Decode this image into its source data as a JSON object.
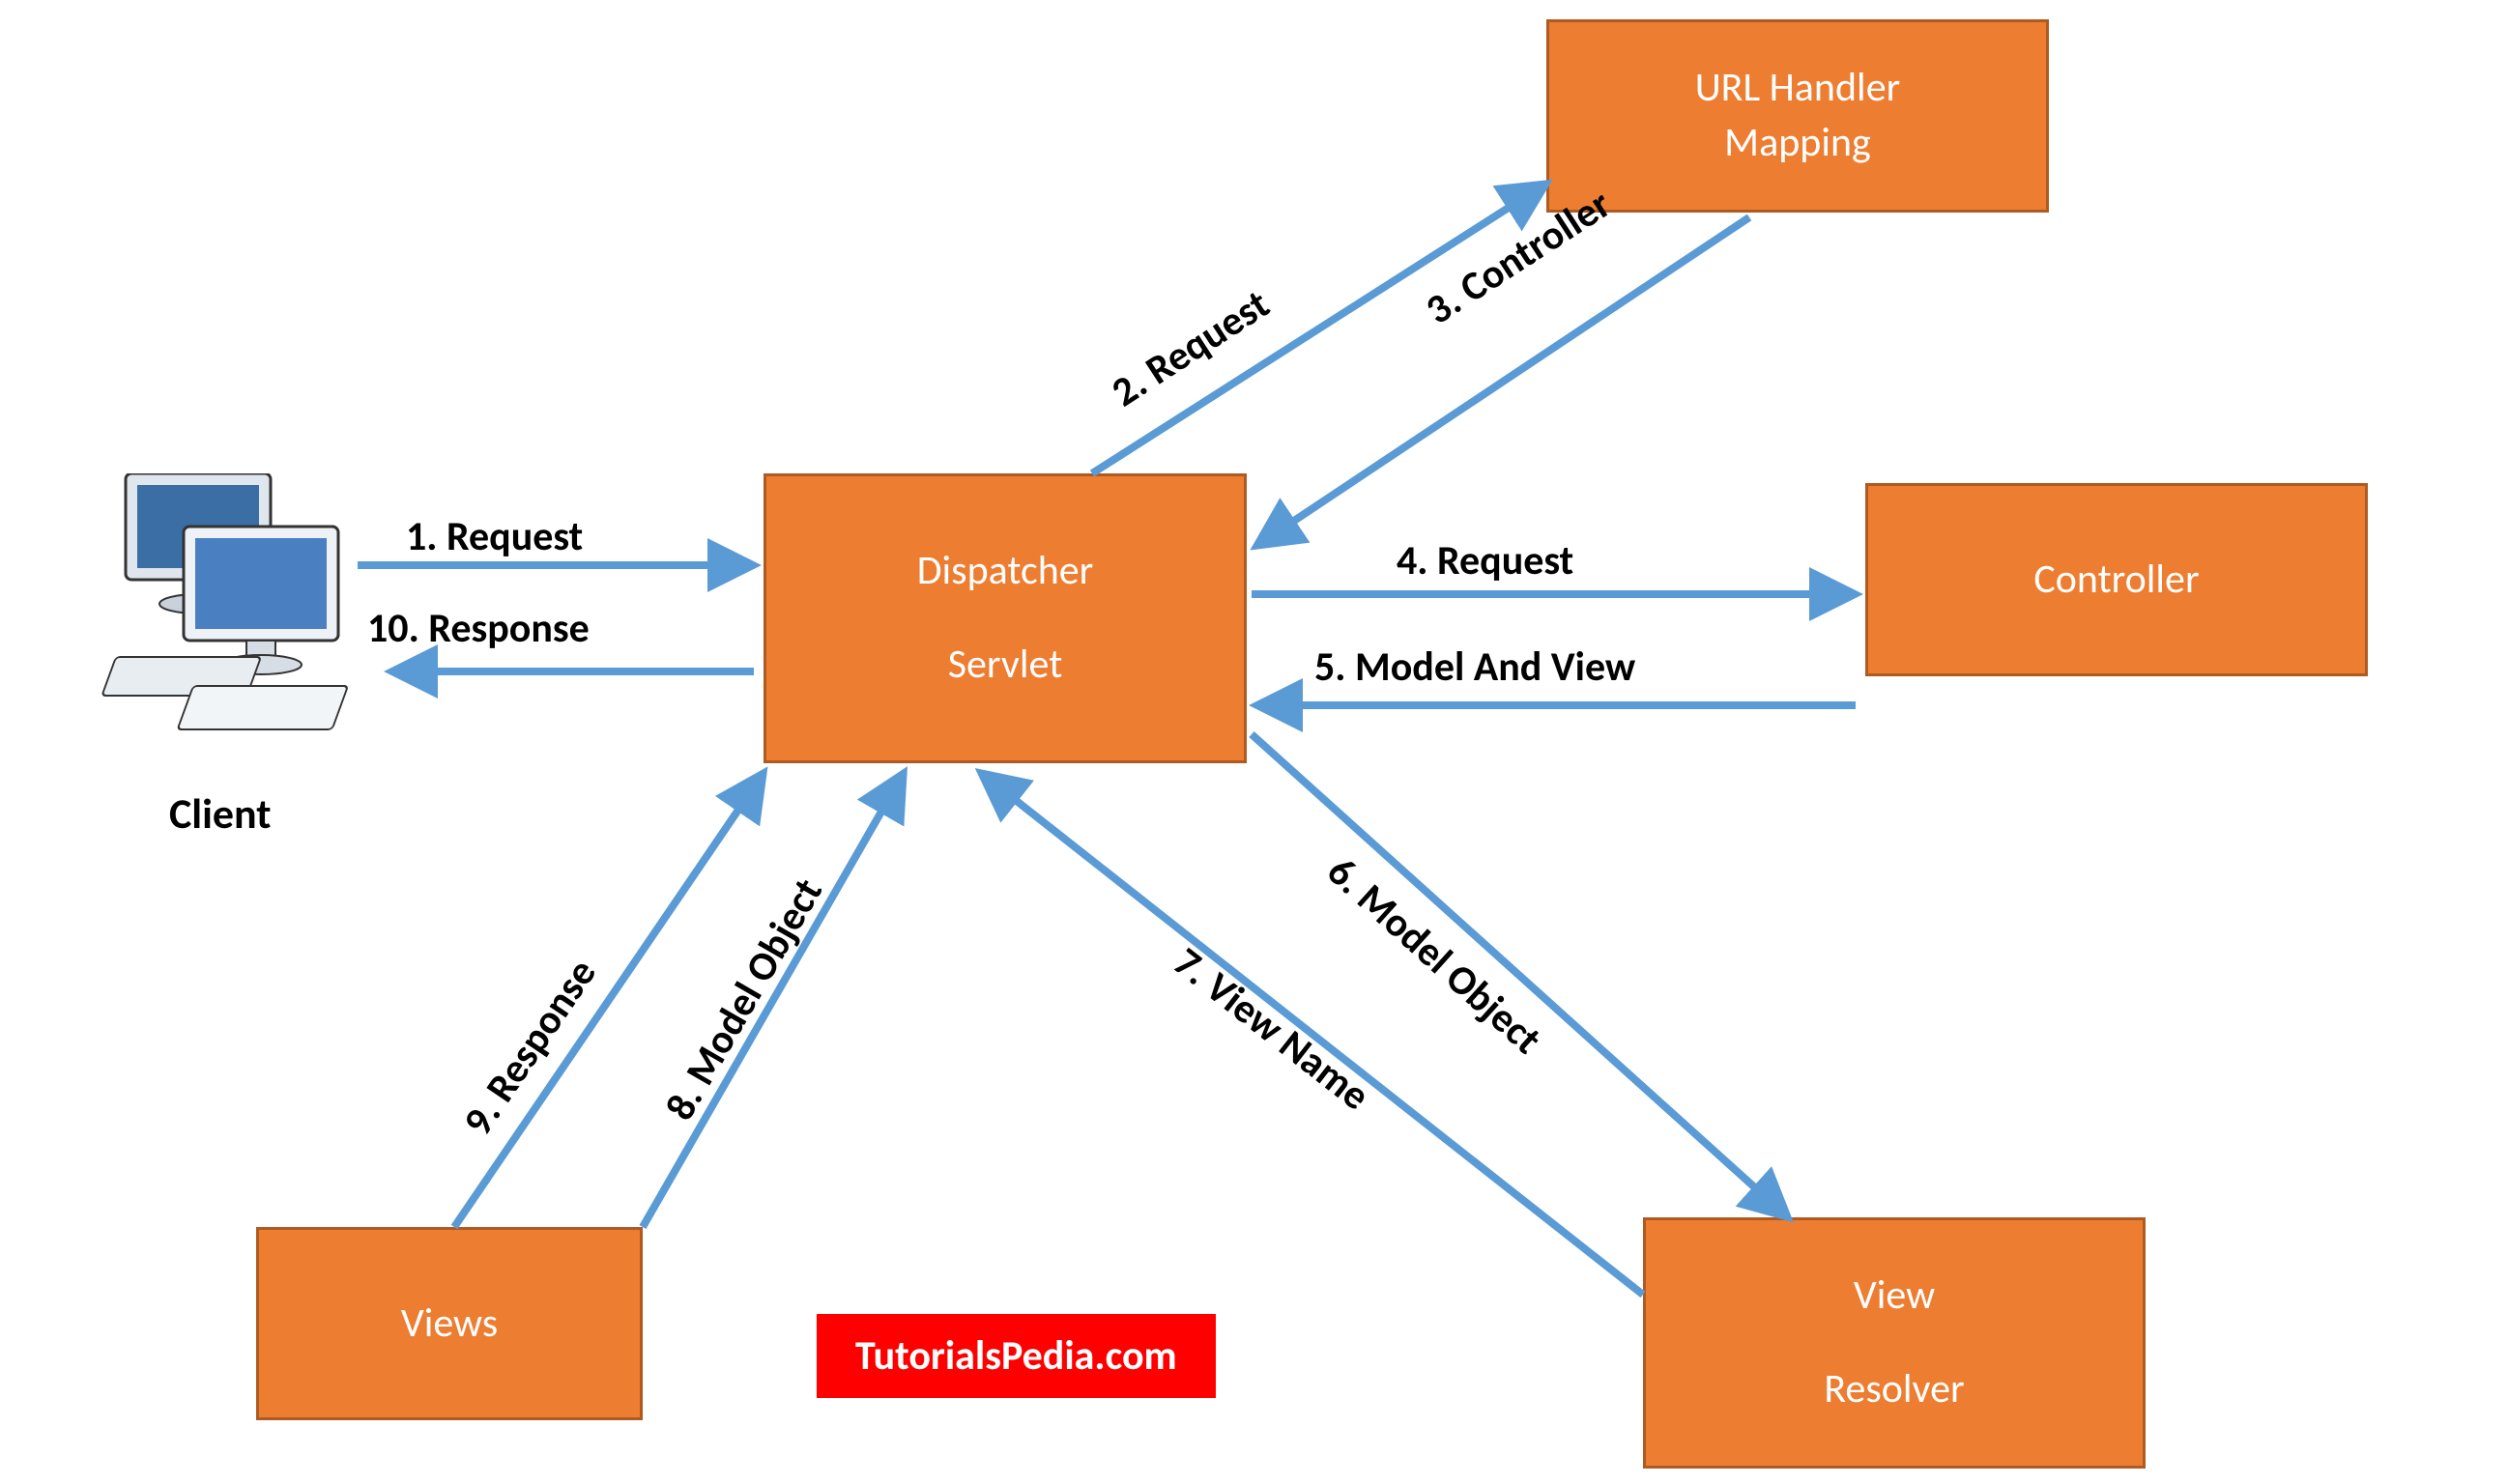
{
  "nodes": {
    "client": {
      "label": "Client"
    },
    "dispatcher": {
      "line1": "Dispatcher",
      "line2": "Servlet"
    },
    "url_handler": {
      "line1": "URL Handler",
      "line2": "Mapping"
    },
    "controller": {
      "label": "Controller"
    },
    "view_resolver": {
      "line1": "View",
      "line2": "Resolver"
    },
    "views": {
      "label": "Views"
    }
  },
  "edges": {
    "e1": "1. Request",
    "e2": "2. Request",
    "e3": "3. Controller",
    "e4": "4. Request",
    "e5": "5. Model And View",
    "e6": "6. Model Object",
    "e7": "7. View Name",
    "e8": "8. Model Object",
    "e9": "9. Response",
    "e10": "10. Response"
  },
  "watermark": "TutorialsPedia.com",
  "colors": {
    "box_fill": "#ED7D31",
    "box_border": "#AE5A21",
    "arrow": "#5B9BD5",
    "watermark_bg": "#FF0000"
  }
}
